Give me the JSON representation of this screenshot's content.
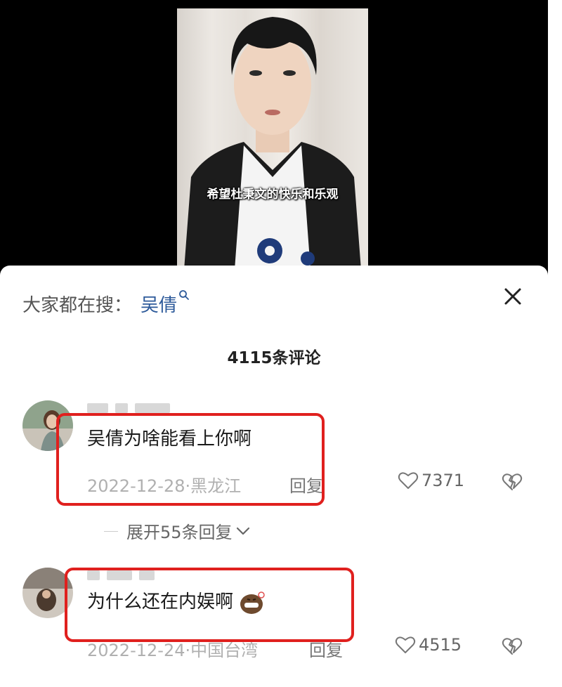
{
  "video": {
    "subtitle": "希望杜秉文的快乐和乐观"
  },
  "sheet": {
    "search_hint_label": "大家都在搜：",
    "search_term": "吴倩",
    "comment_count": "4115条评论"
  },
  "comments": [
    {
      "text": "吴倩为啥能看上你啊",
      "date": "2022-12-28",
      "location": "黑龙江",
      "reply_label": "回复",
      "likes": "7371",
      "expand_label": "展开55条回复"
    },
    {
      "text": "为什么还在内娱啊",
      "date": "2022-12-24",
      "location": "中国台湾",
      "reply_label": "回复",
      "likes": "4515"
    }
  ],
  "colors": {
    "highlight": "#e0201e",
    "search_term": "#2d5a9a"
  }
}
